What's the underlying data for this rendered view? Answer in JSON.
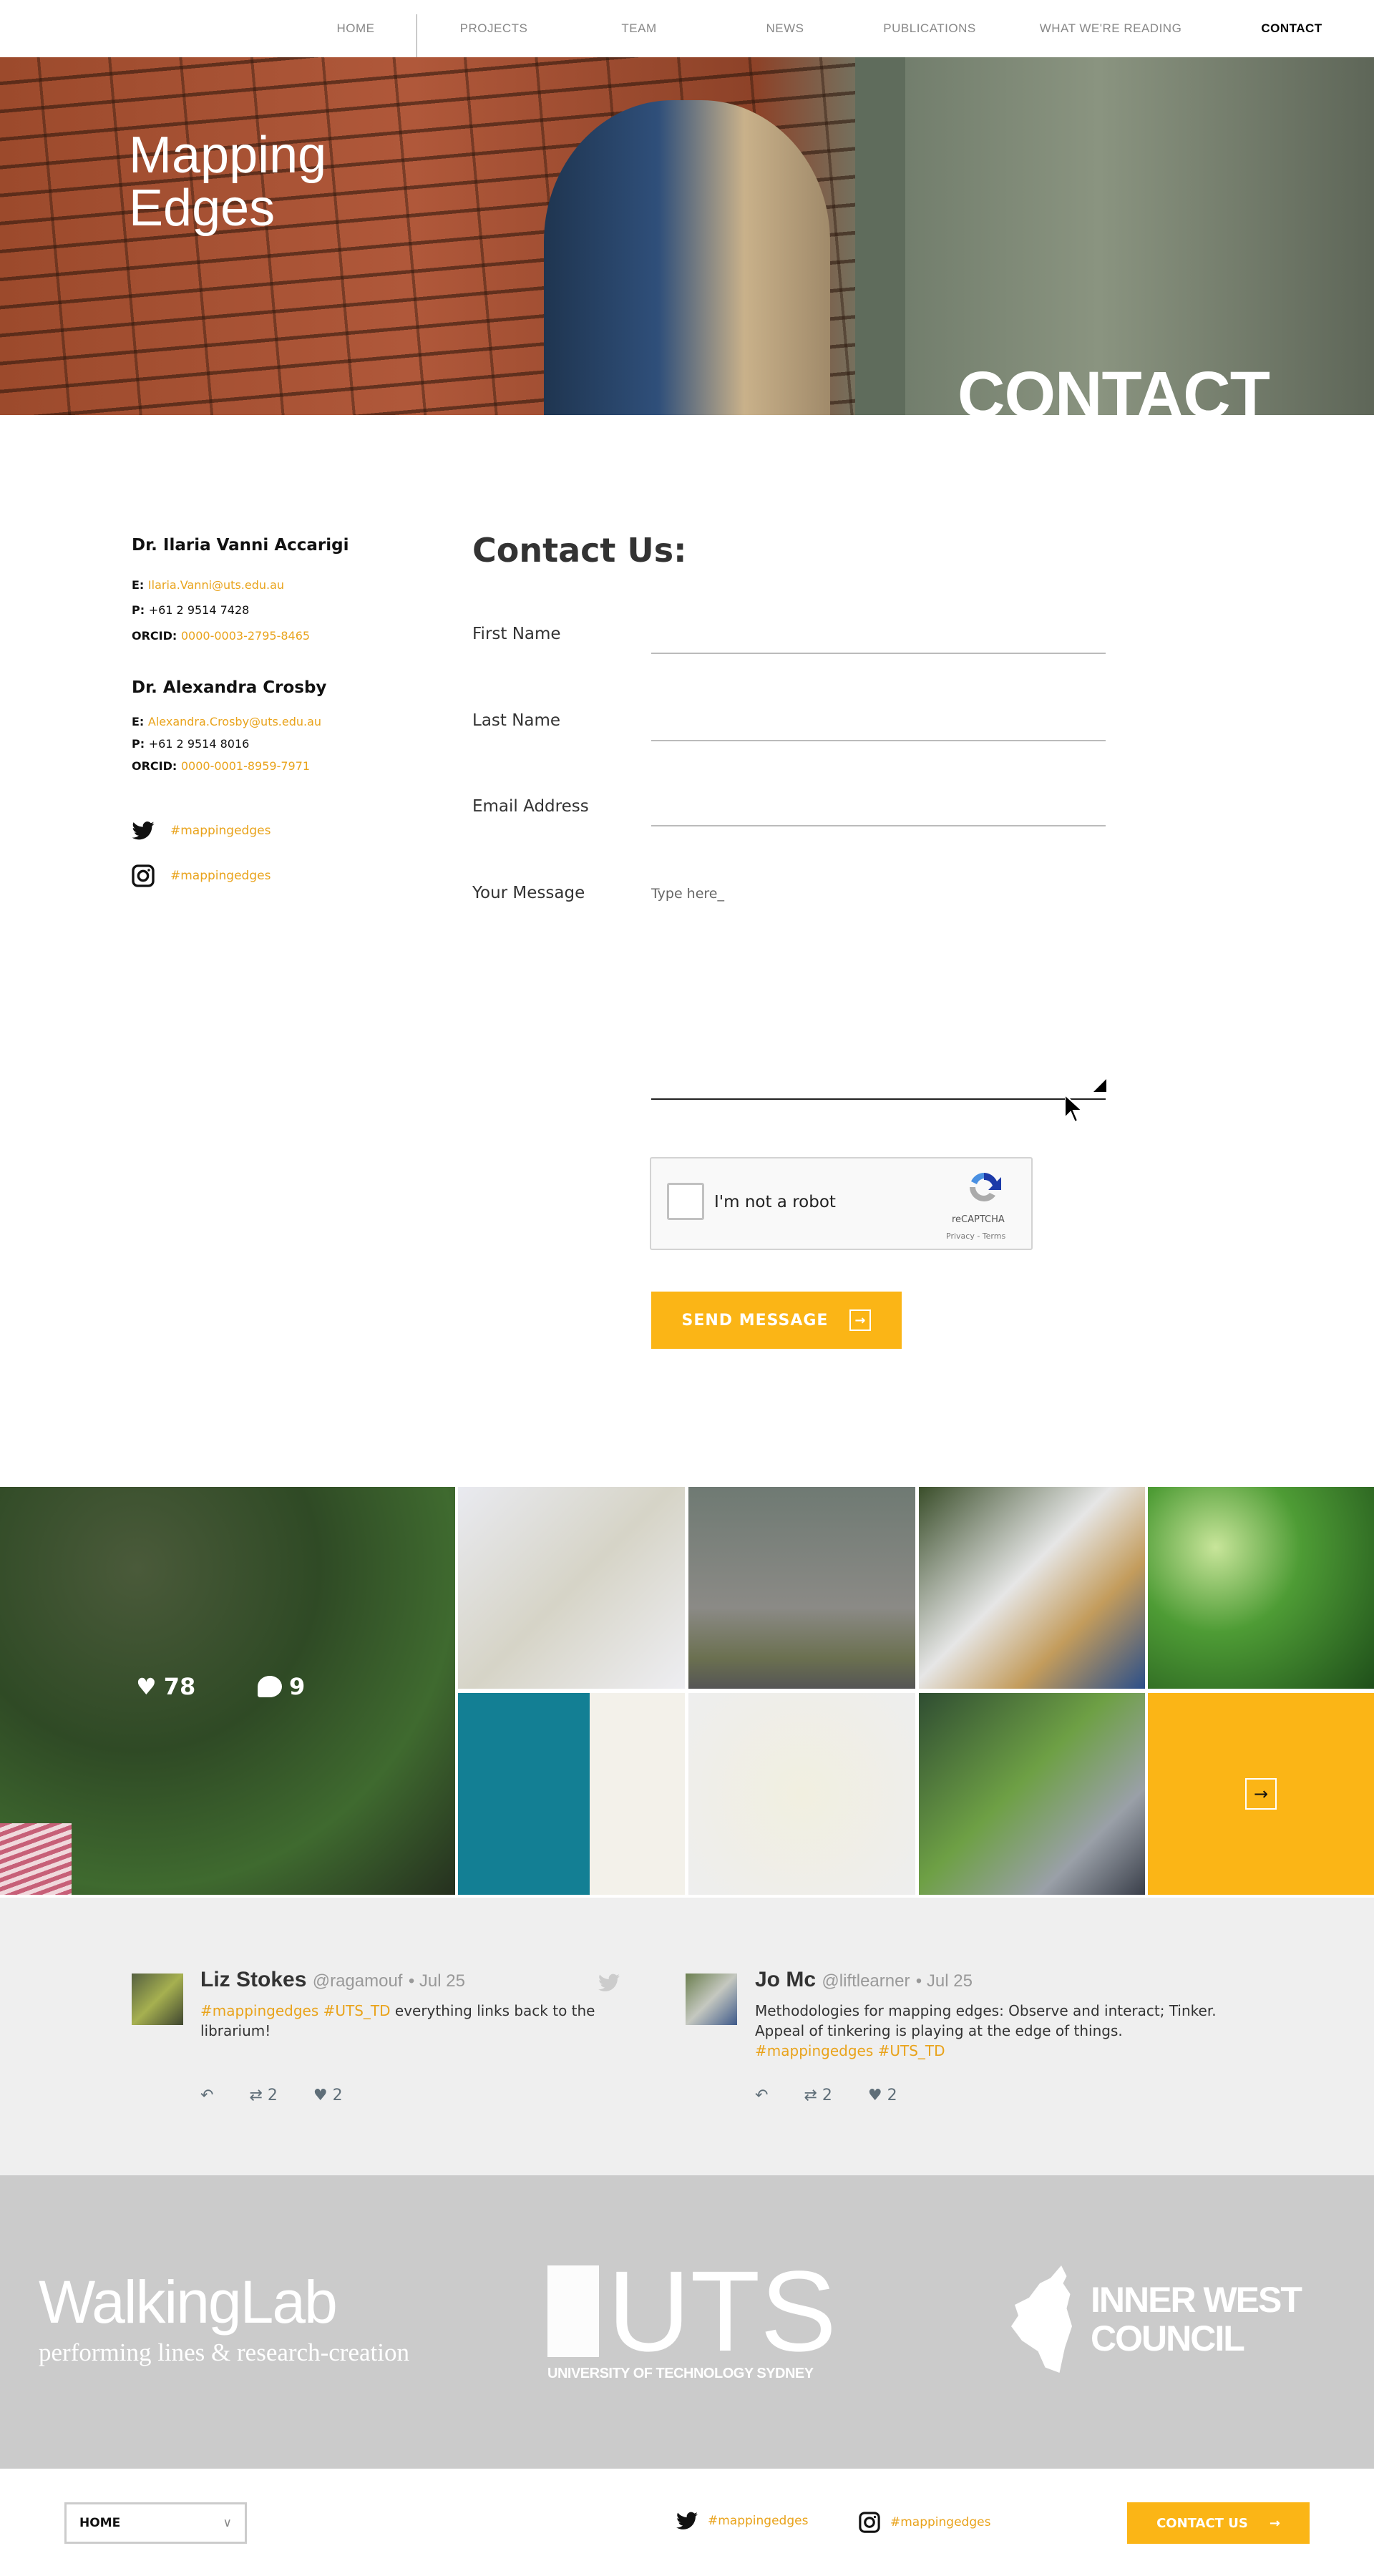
{
  "nav": {
    "items": [
      "HOME",
      "PROJECTS",
      "TEAM",
      "NEWS",
      "PUBLICATIONS",
      "WHAT WE'RE READING",
      "CONTACT"
    ],
    "active": "CONTACT"
  },
  "hero": {
    "logo_line1": "Mapping",
    "logo_line2": "Edges",
    "title": "CONTACT"
  },
  "contacts": [
    {
      "name": "Dr. Ilaria Vanni Accarigi",
      "email_label": "E:",
      "email": "Ilaria.Vanni@uts.edu.au",
      "phone_label": "P:",
      "phone": "+61 2 9514 7428",
      "orcid_label": "ORCID:",
      "orcid": "0000-0003-2795-8465"
    },
    {
      "name": "Dr. Alexandra Crosby",
      "email_label": "E:",
      "email": "Alexandra.Crosby@uts.edu.au",
      "phone_label": "P:",
      "phone": "+61 2 9514 8016",
      "orcid_label": "ORCID:",
      "orcid": "0000-0001-8959-7971"
    }
  ],
  "social": {
    "twitter": "#mappingedges",
    "instagram": "#mappingedges"
  },
  "form": {
    "title": "Contact Us:",
    "first_name": "First Name",
    "last_name": "Last Name",
    "email": "Email Address",
    "message": "Your Message",
    "message_placeholder": "Type here_",
    "captcha_label": "I'm not a robot",
    "captcha_brand": "reCAPTCHA",
    "captcha_links": "Privacy - Terms",
    "submit": "SEND MESSAGE"
  },
  "instagram_feed": {
    "likes": "78",
    "comments": "9"
  },
  "tweets": [
    {
      "name": "Liz Stokes",
      "handle": "@ragamouf",
      "date": "• Jul 25",
      "hashtags": "#mappingedges #UTS_TD",
      "text": " everything links back to the librarium!",
      "trailing_tags": "",
      "retweets": "2",
      "likes": "2"
    },
    {
      "name": "Jo Mc",
      "handle": "@liftlearner",
      "date": "• Jul 25",
      "hashtags": "",
      "text": "Methodologies for mapping edges: Observe and interact; Tinker. Appeal of tinkering is playing at the edge of things.",
      "trailing_tags": "#mappingedges #UTS_TD",
      "retweets": "2",
      "likes": "2"
    }
  ],
  "partners": {
    "walkinglab": "WalkingLab",
    "walkinglab_sub": "performing lines & research-creation",
    "uts": "UTS",
    "uts_sub": "UNIVERSITY OF TECHNOLOGY SYDNEY",
    "council_line1": "INNER WEST",
    "council_line2": "COUNCIL"
  },
  "footer": {
    "select_value": "HOME",
    "twitter": "#mappingedges",
    "instagram": "#mappingedges",
    "contact_button": "CONTACT US"
  },
  "colors": {
    "accent": "#fbb516",
    "link": "#e9a31b",
    "tweet_bg": "#efefef",
    "logos_bg": "#cbcbcb"
  }
}
